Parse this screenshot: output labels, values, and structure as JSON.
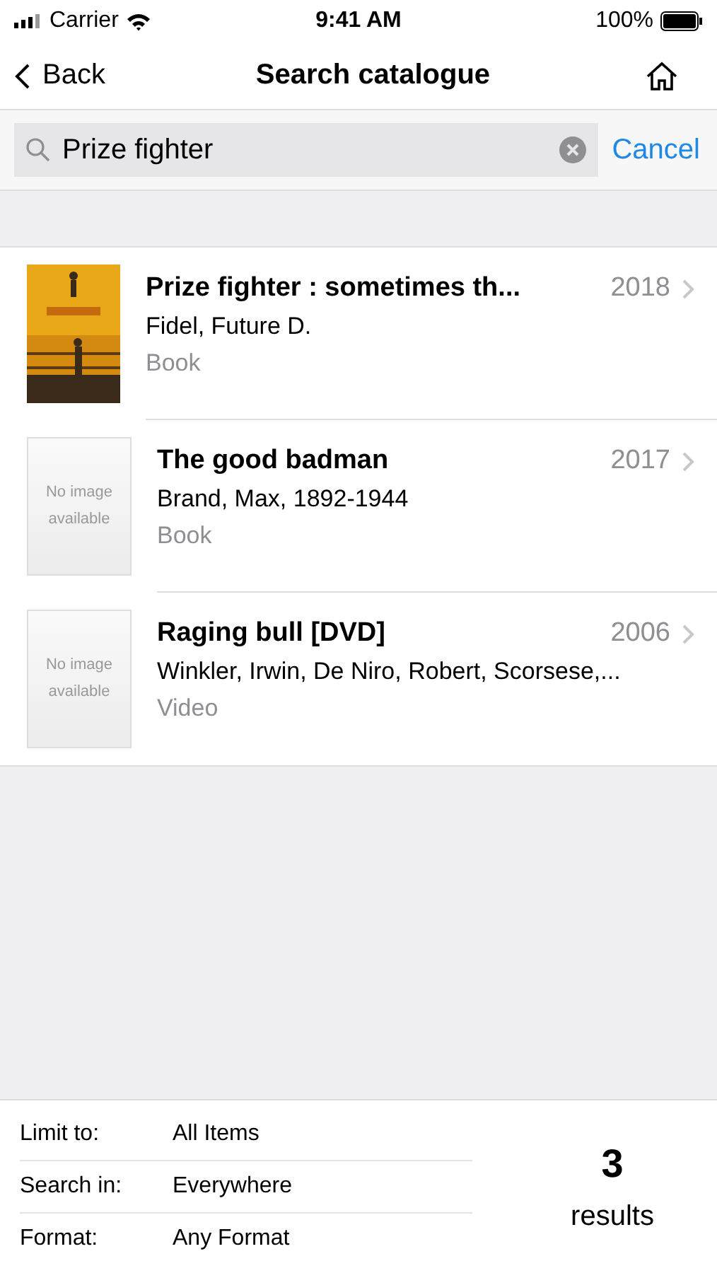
{
  "status_bar": {
    "carrier": "Carrier",
    "time": "9:41 AM",
    "battery": "100%"
  },
  "nav": {
    "back": "Back",
    "title": "Search catalogue"
  },
  "search": {
    "value": "Prize fighter",
    "cancel": "Cancel"
  },
  "results": [
    {
      "title": "Prize fighter : sometimes th...",
      "year": "2018",
      "author": "Fidel, Future D.",
      "format": "Book"
    },
    {
      "title": "The good badman",
      "year": "2017",
      "author": "Brand, Max, 1892-1944",
      "format": "Book",
      "cover": {
        "kind": "placeholder",
        "text": "No image available"
      }
    },
    {
      "title": "Raging bull [DVD]",
      "year": "2006",
      "author": "Winkler, Irwin, De Niro, Robert, Scorsese,...",
      "format": "Video",
      "cover": {
        "kind": "placeholder",
        "text": "No image available"
      }
    }
  ],
  "filters": [
    {
      "label": "Limit to:",
      "value": "All Items"
    },
    {
      "label": "Search in:",
      "value": "Everywhere"
    },
    {
      "label": "Format:",
      "value": "Any Format"
    }
  ],
  "count": {
    "number": "3",
    "label": "results"
  }
}
